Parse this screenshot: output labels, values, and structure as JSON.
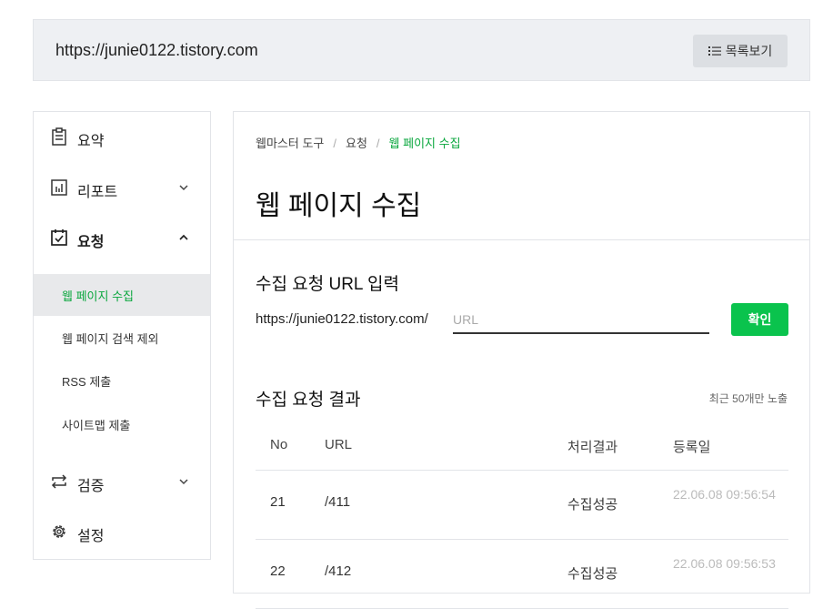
{
  "topbar": {
    "site_url": "https://junie0122.tistory.com",
    "list_button_label": "목록보기"
  },
  "sidebar": {
    "items": [
      {
        "label": "요약",
        "icon": "clipboard-icon"
      },
      {
        "label": "리포트",
        "icon": "report-chart-icon",
        "expanded": false
      },
      {
        "label": "요청",
        "icon": "checkbox-icon",
        "expanded": true
      },
      {
        "label": "검증",
        "icon": "swap-arrows-icon",
        "expanded": false
      },
      {
        "label": "설정",
        "icon": "gear-icon"
      }
    ],
    "subitems": [
      {
        "label": "웹 페이지 수집",
        "active": true
      },
      {
        "label": "웹 페이지 검색 제외"
      },
      {
        "label": "RSS 제출"
      },
      {
        "label": "사이트맵 제출"
      }
    ]
  },
  "breadcrumb": [
    "웹마스터 도구",
    "요청",
    "웹 페이지 수집"
  ],
  "breadcrumb_sep": "/",
  "page_title": "웹 페이지 수집",
  "request_section": {
    "title": "수집 요청 URL 입력",
    "url_prefix": "https://junie0122.tistory.com/",
    "input_placeholder": "URL",
    "input_value": "",
    "confirm_label": "확인"
  },
  "result_section": {
    "title": "수집 요청 결과",
    "note": "최근 50개만 노출",
    "columns": [
      "No",
      "URL",
      "처리결과",
      "등록일"
    ],
    "rows": [
      {
        "no": "21",
        "url": "/411",
        "result": "수집성공",
        "date": "22.06.08 09:56:54"
      },
      {
        "no": "22",
        "url": "/412",
        "result": "수집성공",
        "date": "22.06.08 09:56:53"
      }
    ]
  },
  "colors": {
    "accent": "#0ac34d",
    "active_text": "#08a63c",
    "active_bg": "#e8e9eb"
  }
}
